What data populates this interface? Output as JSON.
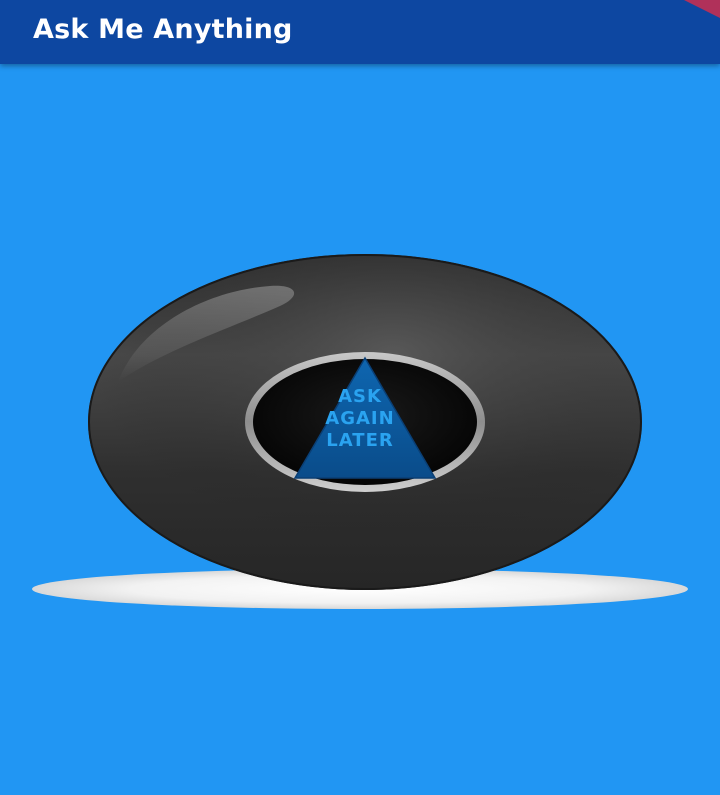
{
  "app_bar": {
    "title": "Ask Me Anything",
    "background_color": "#0D47A1",
    "title_color": "#FFFFFF"
  },
  "page": {
    "background_color": "#2196F3"
  },
  "magic_ball": {
    "answer_lines": [
      "ASK",
      "AGAIN",
      "LATER"
    ],
    "answer_color": "#2AA3F0",
    "triangle_color": "#0B5A9E",
    "ball_color": "#2B2B2B"
  }
}
